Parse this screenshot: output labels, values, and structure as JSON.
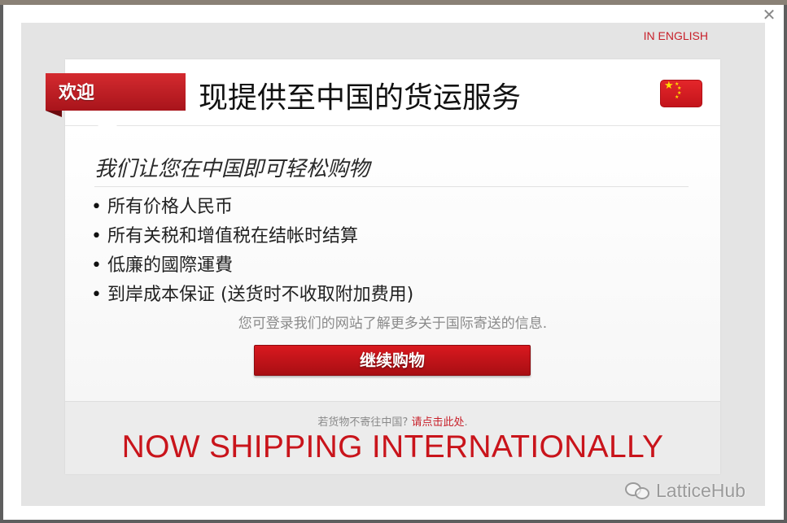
{
  "modal": {
    "close_symbol": "✕",
    "lang_link": "IN ENGLISH"
  },
  "header": {
    "ribbon": "欢迎",
    "headline": "现提供至中国的货运服务",
    "flag_icon": "china-flag-icon"
  },
  "body": {
    "subtitle": "我们让您在中国即可轻松购物",
    "benefits": [
      "所有价格人民币",
      "所有关税和增值税在结帐时结算",
      "低廉的國際運費",
      "到岸成本保证 (送货时不收取附加费用)"
    ],
    "info_text": "您可登录我们的网站了解更多关于国际寄送的信息.",
    "continue_button": "继续购物"
  },
  "footer": {
    "question": "若货物不寄往中国? ",
    "link": "请点击此处",
    "link_suffix": ".",
    "big_text": "NOW SHIPPING INTERNATIONALLY"
  },
  "watermark": {
    "icon": "wechat-icon",
    "text": "LatticeHub"
  },
  "colors": {
    "accent_red": "#c9141b",
    "button_red": "#d9191f",
    "muted_text": "#8a8a8a"
  }
}
